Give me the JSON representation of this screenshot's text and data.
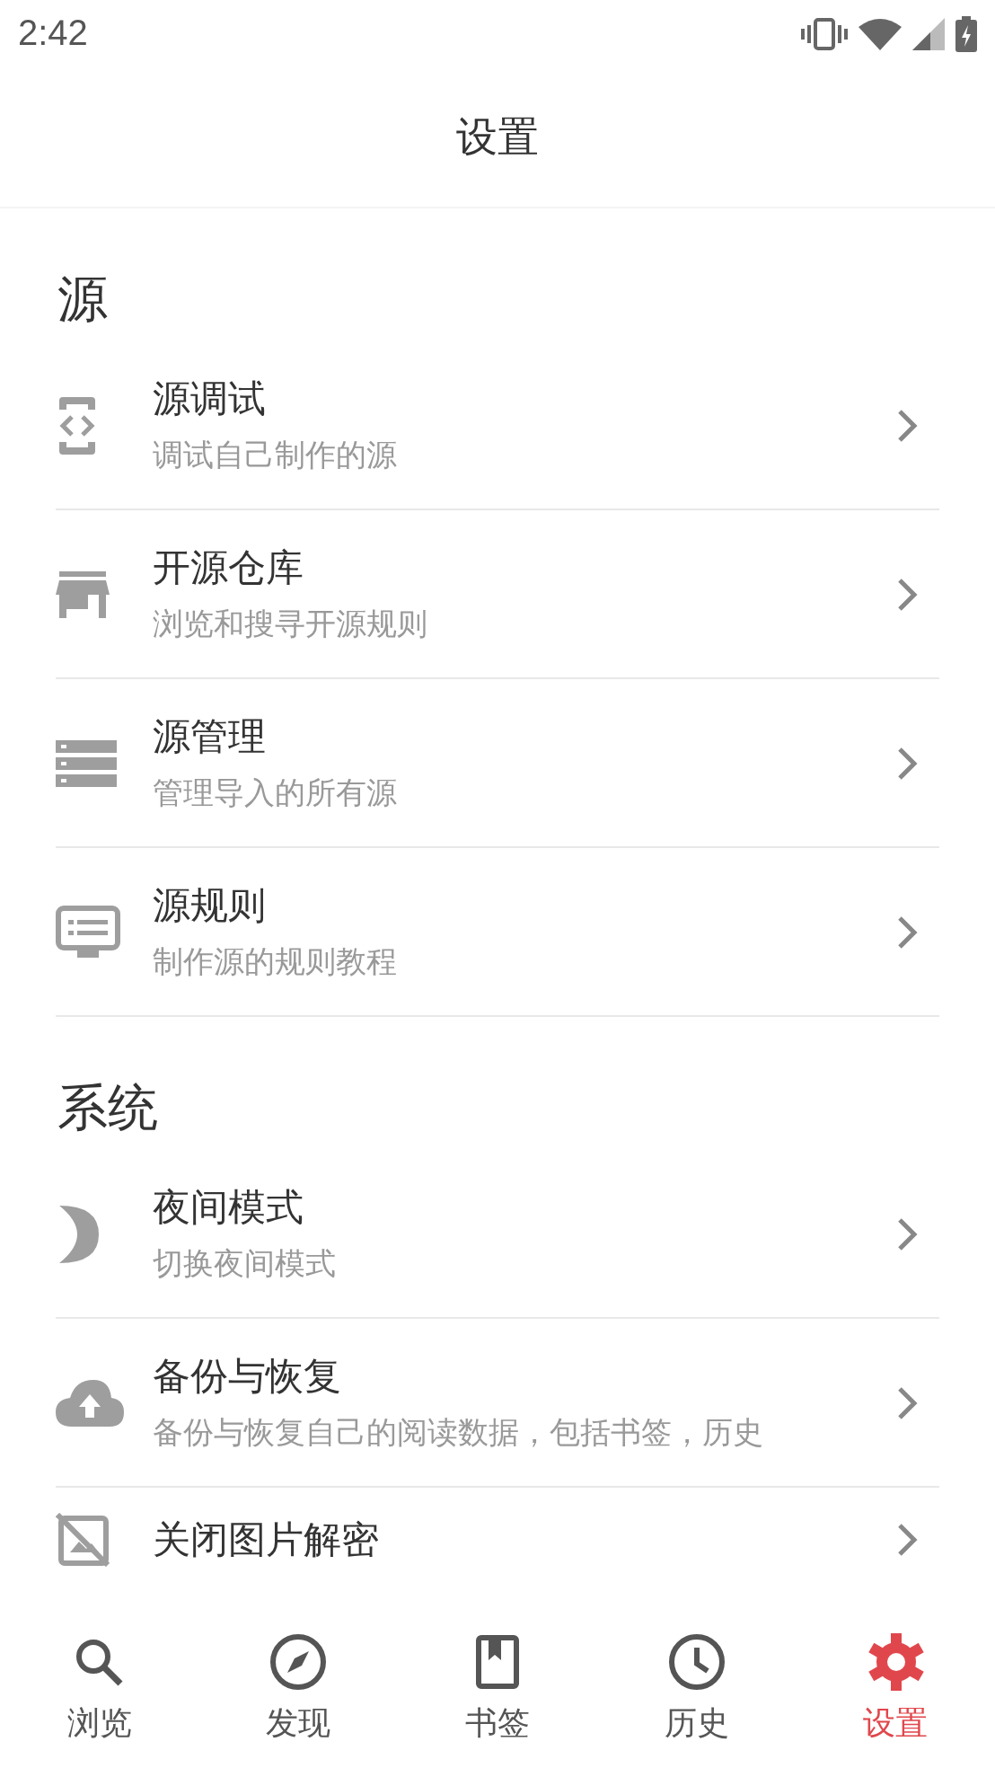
{
  "status_bar": {
    "time": "2:42"
  },
  "title": "设置",
  "sections": [
    {
      "title": "源",
      "items": [
        {
          "title": "源调试",
          "subtitle": "调试自己制作的源"
        },
        {
          "title": "开源仓库",
          "subtitle": "浏览和搜寻开源规则"
        },
        {
          "title": "源管理",
          "subtitle": "管理导入的所有源"
        },
        {
          "title": "源规则",
          "subtitle": "制作源的规则教程"
        }
      ]
    },
    {
      "title": "系统",
      "items": [
        {
          "title": "夜间模式",
          "subtitle": "切换夜间模式"
        },
        {
          "title": "备份与恢复",
          "subtitle": "备份与恢复自己的阅读数据，包括书签，历史"
        },
        {
          "title": "关闭图片解密"
        }
      ]
    }
  ],
  "tabs": [
    {
      "label": "浏览",
      "selected": false
    },
    {
      "label": "发现",
      "selected": false
    },
    {
      "label": "书签",
      "selected": false
    },
    {
      "label": "历史",
      "selected": false
    },
    {
      "label": "设置",
      "selected": true
    }
  ]
}
